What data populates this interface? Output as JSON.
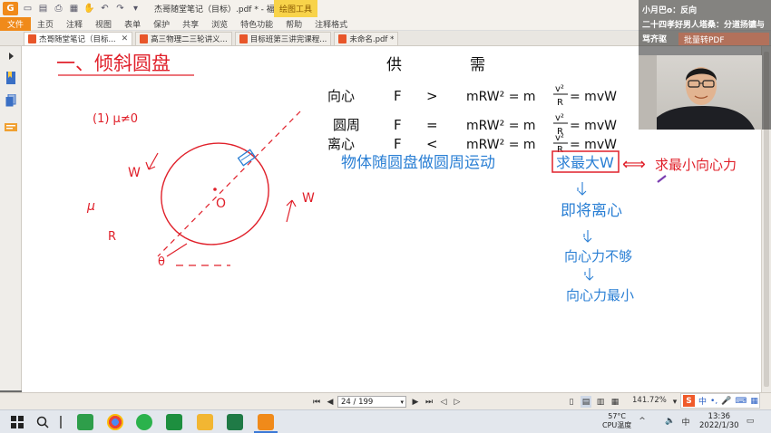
{
  "titlebar": {
    "title": "杰哥随堂笔记（目标）.pdf * - 福昕阅读器",
    "context_tab": "绘图工具"
  },
  "ribbon": {
    "tabs": [
      "文件",
      "主页",
      "注释",
      "视图",
      "表单",
      "保护",
      "共享",
      "浏览",
      "特色功能",
      "帮助",
      "注释格式"
    ]
  },
  "doc_tabs": [
    {
      "label": "杰哥随堂笔记（目标...",
      "active": true
    },
    {
      "label": "高三物理二三轮讲义...",
      "active": false
    },
    {
      "label": "目标班第三讲完课程...",
      "active": false
    },
    {
      "label": "未命名.pdf *",
      "active": false
    }
  ],
  "overlay": {
    "line1": "小月巴o：反向",
    "line2": "二十四孝好男人塔桑：分道扬镳与",
    "line3": "骂齐驱",
    "button": "批量转PDF"
  },
  "notes": {
    "heading": "一、倾斜圆盘",
    "case_label": "(1) μ≠0",
    "label_w1": "W",
    "label_mu": "μ",
    "label_O": "O",
    "label_R": "R",
    "label_theta": "θ",
    "label_w2": "W",
    "supply": "供",
    "demand": "需",
    "row1": [
      "向心",
      "F",
      ">",
      "mRW² = m",
      "v²",
      "R",
      "= mvW"
    ],
    "row2": [
      "圆周",
      "F",
      "=",
      "mRW² = m",
      "v²",
      "R",
      "= mvW"
    ],
    "row3": [
      "离心",
      "F",
      "<",
      "mRW² = m",
      "v²",
      "R",
      "= mvW"
    ],
    "sentence": "物体随圆盘做圆周运动",
    "boxed": "求最大W",
    "arrow_text": "⟺",
    "right_text": "求最小向心力",
    "step1": "即将离心",
    "step2": "向心力不够",
    "step3": "向心力最小"
  },
  "statusbar": {
    "page_value": "24 / 199",
    "zoom": "141.72%"
  },
  "taskbar": {
    "temperature": "57°C",
    "temp_label": "CPU温度",
    "ime": "中",
    "time": "13:36",
    "date": "2022/1/30"
  },
  "colors": {
    "ink_red": "#e0202a",
    "ink_blue": "#2a7fd4",
    "ink_black": "#111111",
    "accent_orange": "#f08a1a"
  }
}
